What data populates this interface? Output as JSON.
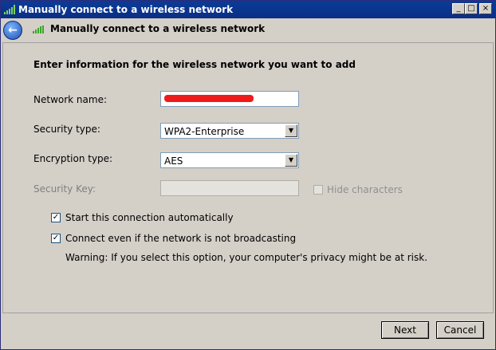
{
  "window": {
    "title": "Manually connect to a wireless network",
    "controls": {
      "minimize": "_",
      "maximize": "□",
      "close": "×"
    }
  },
  "nav": {
    "back_icon": "back-arrow-icon",
    "title": "Manually connect to a wireless network"
  },
  "form": {
    "heading": "Enter information for the wireless network you want to add",
    "network_name_label": "Network name:",
    "network_name_value": "",
    "security_type_label": "Security type:",
    "security_type_value": "WPA2-Enterprise",
    "encryption_type_label": "Encryption type:",
    "encryption_type_value": "AES",
    "security_key_label": "Security Key:",
    "hide_characters_label": "Hide characters",
    "start_auto_label": "Start this connection automatically",
    "start_auto_checked": true,
    "connect_hidden_label": "Connect even if the network is not broadcasting",
    "connect_hidden_checked": true,
    "warning": "Warning: If you select this option, your computer's privacy might be at risk."
  },
  "buttons": {
    "next": "Next",
    "cancel": "Cancel"
  },
  "colors": {
    "titlebar": "#0b3b96",
    "redaction": "#ef1b1b",
    "window_bg": "#d4d0c8"
  }
}
